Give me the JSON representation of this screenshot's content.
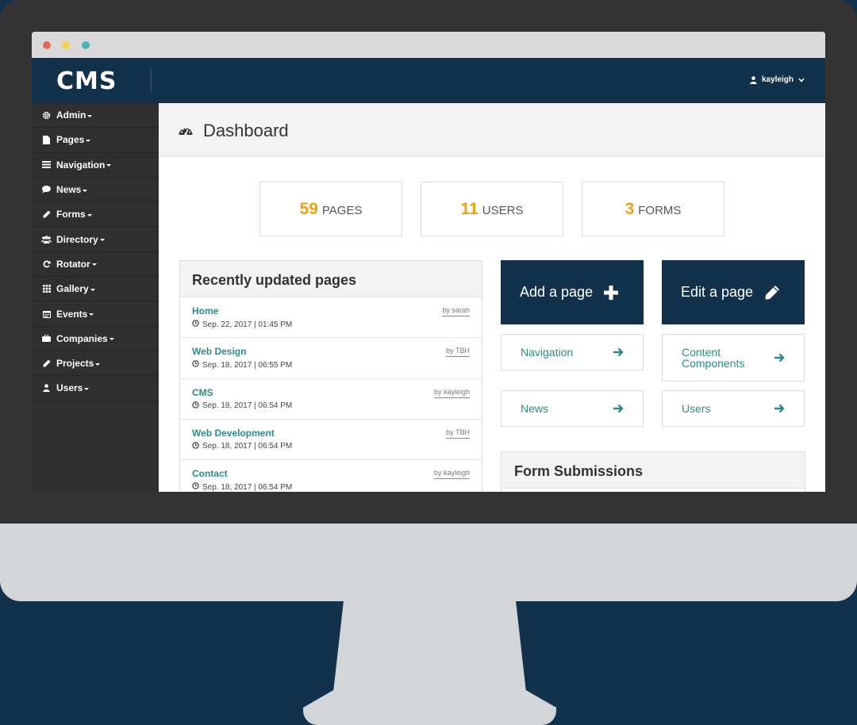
{
  "app": {
    "brand": "CMS",
    "user": "kayleigh"
  },
  "sidebar": {
    "items": [
      {
        "label": "Admin",
        "icon": "gear-icon"
      },
      {
        "label": "Pages",
        "icon": "file-icon"
      },
      {
        "label": "Navigation",
        "icon": "list-icon"
      },
      {
        "label": "News",
        "icon": "comment-icon"
      },
      {
        "label": "Forms",
        "icon": "pencil-icon"
      },
      {
        "label": "Directory",
        "icon": "users-icon"
      },
      {
        "label": "Rotator",
        "icon": "refresh-icon"
      },
      {
        "label": "Gallery",
        "icon": "grid-icon"
      },
      {
        "label": "Events",
        "icon": "calendar-icon"
      },
      {
        "label": "Companies",
        "icon": "briefcase-icon"
      },
      {
        "label": "Projects",
        "icon": "pencil-icon"
      },
      {
        "label": "Users",
        "icon": "user-icon"
      }
    ]
  },
  "header": {
    "title": "Dashboard",
    "icon": "dashboard-icon"
  },
  "stats": [
    {
      "value": "59",
      "label": "PAGES"
    },
    {
      "value": "11",
      "label": "USERS"
    },
    {
      "value": "3",
      "label": "FORMS"
    }
  ],
  "recent": {
    "title": "Recently updated pages",
    "rows": [
      {
        "title": "Home",
        "date": "Sep. 22, 2017 | 01:45 PM",
        "by": "by sarah"
      },
      {
        "title": "Web Design",
        "date": "Sep. 18, 2017 | 06:55 PM",
        "by": "by TBH"
      },
      {
        "title": "CMS",
        "date": "Sep. 18, 2017 | 06:54 PM",
        "by": "by kayleigh"
      },
      {
        "title": "Web Development",
        "date": "Sep. 18, 2017 | 06:54 PM",
        "by": "by TBH"
      },
      {
        "title": "Contact",
        "date": "Sep. 18, 2017 | 06:54 PM",
        "by": "by kayleigh"
      }
    ]
  },
  "actions": {
    "add_page": "Add a page",
    "edit_page": "Edit a page",
    "links": {
      "navigation": "Navigation",
      "content_components": "Content Components",
      "news": "News",
      "users": "Users"
    }
  },
  "forms_panel": {
    "title": "Form Submissions"
  },
  "colors": {
    "navy": "#12314a",
    "accent": "#f2a10f",
    "link": "#2e8a8a",
    "sidebar": "#2f2f2f"
  }
}
